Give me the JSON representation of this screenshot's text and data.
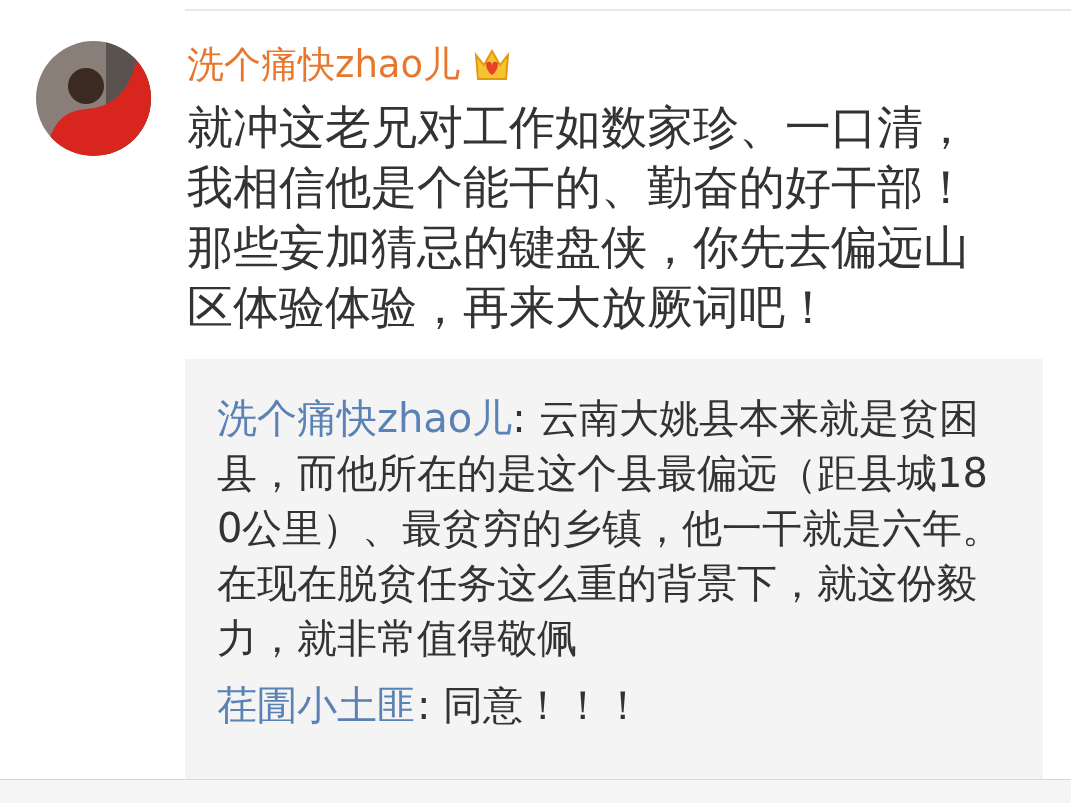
{
  "comment": {
    "author": "洗个痛快zhao儿",
    "vip": true,
    "text": "就冲这老兄对工作如数家珍、一口清，我相信他是个能干的、勤奋的好干部！那些妄加猜忌的键盘侠，你先去偏远山区体验体验，再来大放厥词吧！"
  },
  "replies": [
    {
      "author": "洗个痛快zhao儿",
      "text": ": 云南大姚县本来就是贫困县，而他所在的是这个县最偏远（距县城180公里）、最贫穷的乡镇，他一干就是六年。在现在脱贫任务这么重的背景下，就这份毅力，就非常值得敬佩"
    },
    {
      "author": "荏圊小土匪",
      "text": ": 同意！！！"
    }
  ]
}
